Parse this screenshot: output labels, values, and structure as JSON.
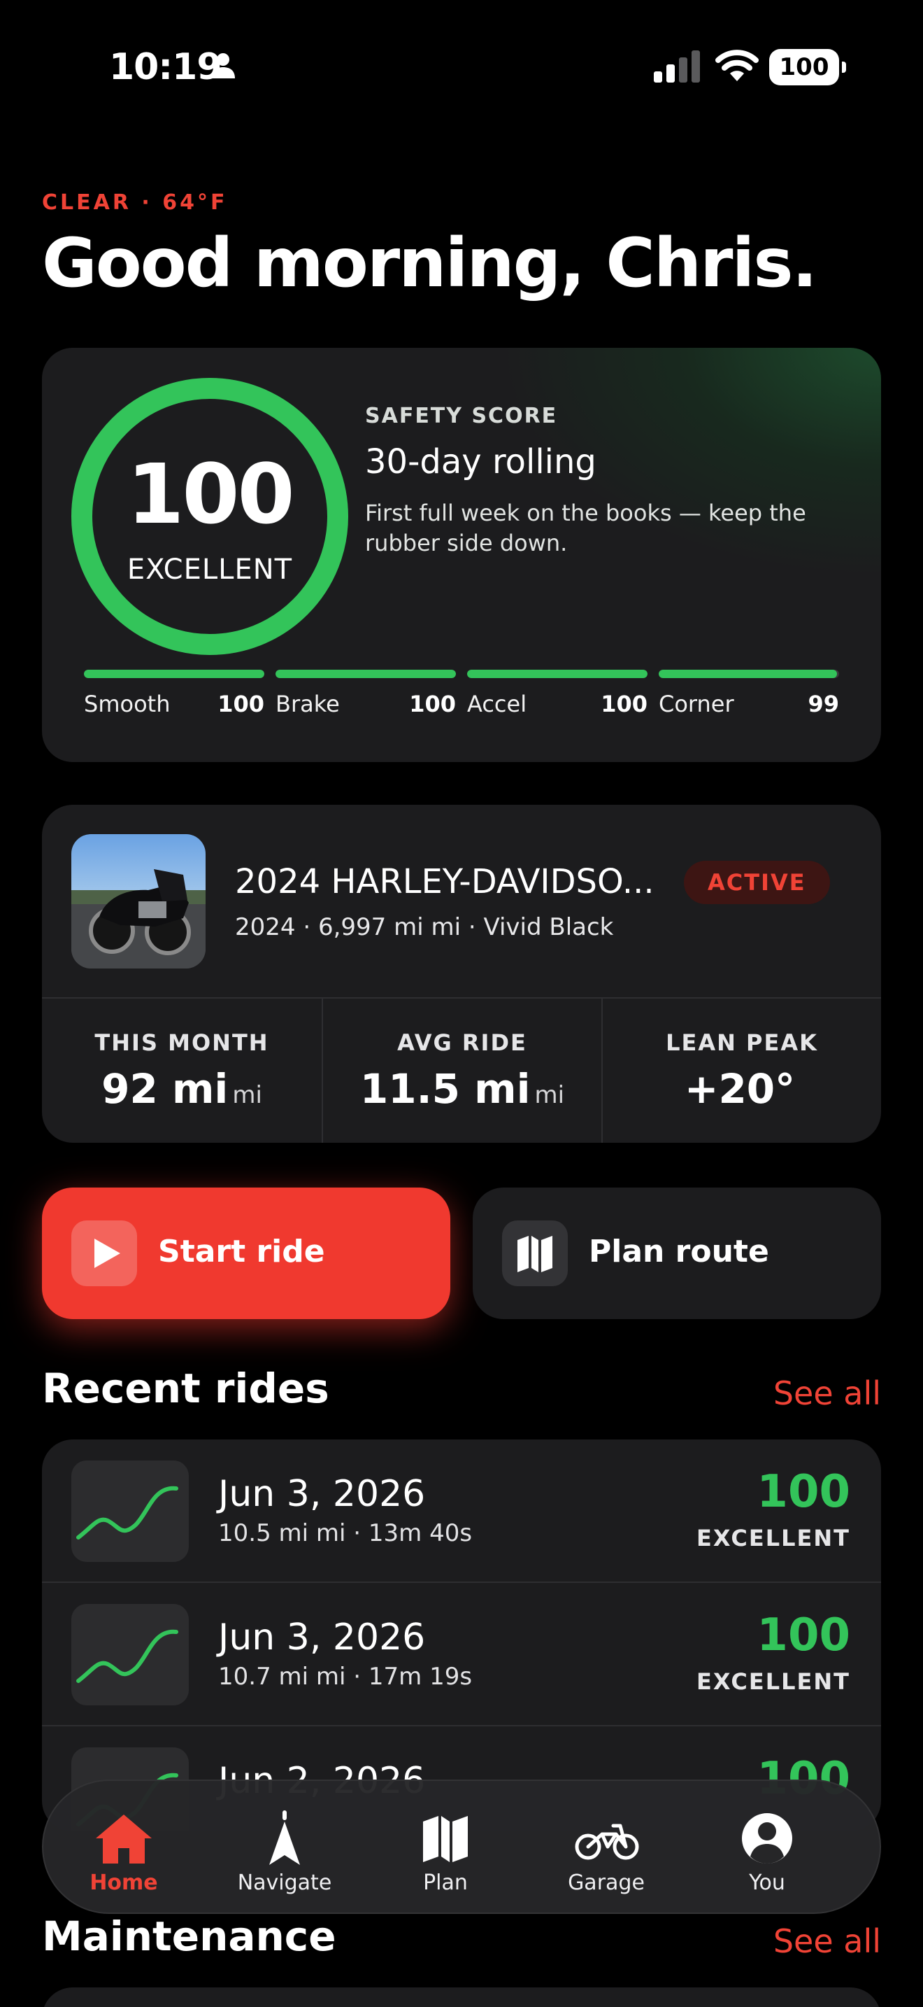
{
  "status_bar": {
    "time": "10:19",
    "battery": "100"
  },
  "header": {
    "weather": "CLEAR · 64°F",
    "greeting": "Good morning, Chris."
  },
  "safety": {
    "score": "100",
    "score_fraction": 1.0,
    "grade": "EXCELLENT",
    "label": "SAFETY SCORE",
    "title": "30-day rolling",
    "description": "First full week on the books — keep the rubber side down.",
    "ring_color": "#33c45a",
    "metrics": [
      {
        "label": "Smooth",
        "value": "100",
        "fraction": 1.0
      },
      {
        "label": "Brake",
        "value": "100",
        "fraction": 1.0
      },
      {
        "label": "Accel",
        "value": "100",
        "fraction": 1.0
      },
      {
        "label": "Corner",
        "value": "99",
        "fraction": 0.99
      }
    ]
  },
  "bike": {
    "name": "2024 HARLEY-DAVIDSO...",
    "badge": "ACTIVE",
    "meta": "2024 · 6,997 mi mi · Vivid Black",
    "stats": [
      {
        "label": "THIS MONTH",
        "value": "92 mi",
        "unit": "mi"
      },
      {
        "label": "AVG RIDE",
        "value": "11.5 mi",
        "unit": "mi"
      },
      {
        "label": "LEAN PEAK",
        "value": "+20°",
        "unit": ""
      }
    ]
  },
  "actions": {
    "start_label": "Start ride",
    "plan_label": "Plan route",
    "accent": "#f0392f"
  },
  "recent_rides": {
    "title": "Recent rides",
    "see_all": "See all",
    "items": [
      {
        "date": "Jun 3, 2026",
        "meta": "10.5 mi mi · 13m 40s",
        "score": "100",
        "grade": "EXCELLENT"
      },
      {
        "date": "Jun 3, 2026",
        "meta": "10.7 mi mi · 17m 19s",
        "score": "100",
        "grade": "EXCELLENT"
      },
      {
        "date": "Jun 2, 2026",
        "meta": "",
        "score": "100",
        "grade": ""
      }
    ]
  },
  "maintenance": {
    "title": "Maintenance",
    "see_all": "See all"
  },
  "tabs": [
    {
      "label": "Home",
      "icon": "home-icon",
      "active": true
    },
    {
      "label": "Navigate",
      "icon": "navigate-icon",
      "active": false
    },
    {
      "label": "Plan",
      "icon": "map-icon",
      "active": false
    },
    {
      "label": "Garage",
      "icon": "motorcycle-icon",
      "active": false
    },
    {
      "label": "You",
      "icon": "person-icon",
      "active": false
    }
  ]
}
